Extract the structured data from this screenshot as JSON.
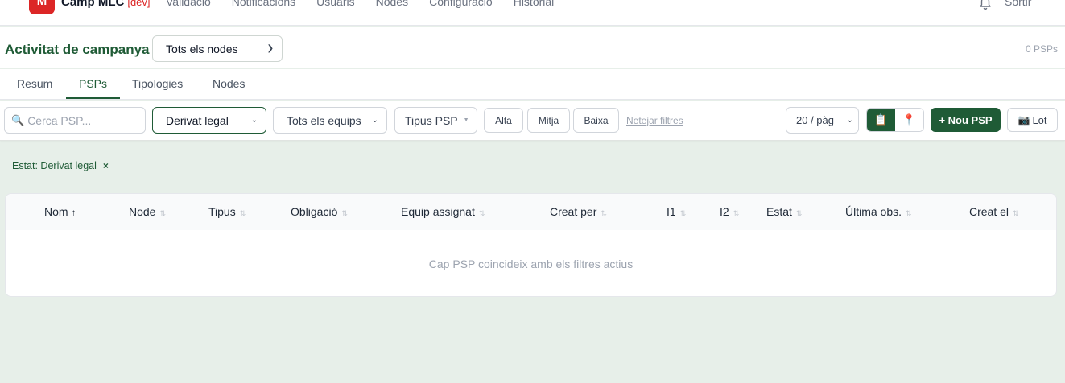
{
  "app": {
    "logo_letter": "M",
    "title": "Camp MLC",
    "env": "[dev]"
  },
  "nav": {
    "links": [
      "Validació",
      "Notificacions",
      "Usuaris",
      "Nodes",
      "Configuració",
      "Historial"
    ],
    "logout": "Sortir"
  },
  "campaign": {
    "title": "Activitat de campanya",
    "node_filter": "Tots els nodes",
    "count": "0 PSPs"
  },
  "tabs": [
    "Resum",
    "PSPs",
    "Tipologies",
    "Nodes"
  ],
  "active_tab": "PSPs",
  "filters": {
    "search_placeholder": "Cerca PSP...",
    "state": "Derivat legal",
    "team": "Tots els equips",
    "type": "Tipus PSP",
    "priorities": [
      "Alta",
      "Mitja",
      "Baixa"
    ],
    "clear": "Netejar filtres",
    "per_page": "20 / pàg",
    "new_button": "+ Nou PSP",
    "batch_button": "Lot"
  },
  "active_filter_chip": {
    "label": "Estat: Derivat legal",
    "remove": "×"
  },
  "table": {
    "columns": [
      "Nom",
      "Node",
      "Tipus",
      "Obligació",
      "Equip assignat",
      "Creat per",
      "I1",
      "I2",
      "Estat",
      "Última obs.",
      "Creat el"
    ],
    "sorted_column": "Nom",
    "sort_direction": "ascending",
    "empty_message": "Cap PSP coincideix amb els filtres actius"
  },
  "icons": {
    "search": "magnifier-icon",
    "bell": "bell-icon",
    "list_view": "clipboard-icon",
    "map_view": "pin-icon",
    "batch": "camera-icon"
  },
  "colors": {
    "brand": "#1f5b36",
    "logo": "#dc2626",
    "background": "#e7efe9"
  }
}
